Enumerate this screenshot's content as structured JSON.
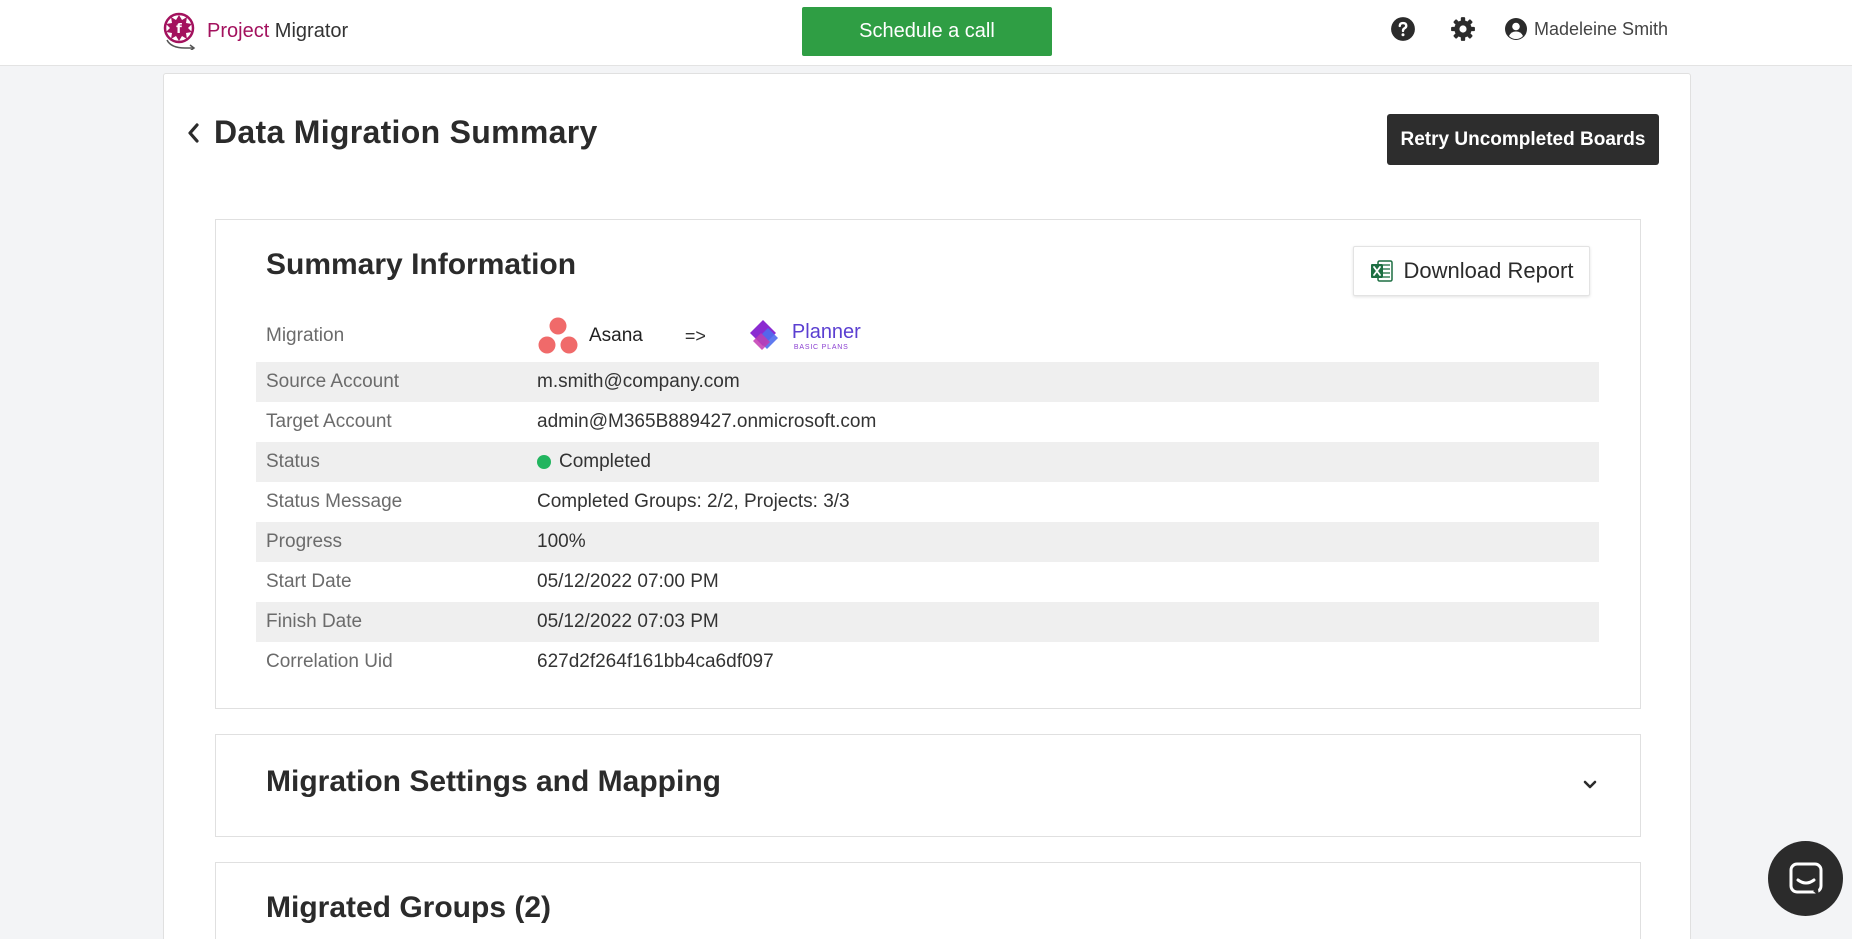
{
  "header": {
    "logo_accent": "Project",
    "logo_rest": " Migrator",
    "schedule_label": "Schedule a call",
    "user_name": "Madeleine Smith",
    "icons": [
      "help-icon",
      "gear-icon",
      "user-icon"
    ]
  },
  "page": {
    "title": "Data Migration Summary",
    "retry_label": "Retry Uncompleted Boards"
  },
  "summary": {
    "title": "Summary Information",
    "download_label": "Download Report",
    "migration_label": "Migration",
    "source_app": "Asana",
    "arrow": "=>",
    "target_app": "Planner",
    "target_sub": "BASIC PLANS",
    "rows": [
      {
        "label": "Source Account",
        "value": "m.smith@company.com"
      },
      {
        "label": "Target Account",
        "value": "admin@M365B889427.onmicrosoft.com"
      },
      {
        "label": "Status",
        "value": "Completed"
      },
      {
        "label": "Status Message",
        "value": "Completed Groups: 2/2, Projects: 3/3"
      },
      {
        "label": "Progress",
        "value": "100%"
      },
      {
        "label": "Start Date",
        "value": "05/12/2022 07:00 PM"
      },
      {
        "label": "Finish Date",
        "value": "05/12/2022 07:03 PM"
      },
      {
        "label": "Correlation Uid",
        "value": "627d2f264f161bb4ca6df097"
      }
    ]
  },
  "settings": {
    "title": "Migration Settings and Mapping"
  },
  "groups": {
    "title": "Migrated Groups (2)"
  },
  "colors": {
    "brand": "#a3125e",
    "schedule_button": "#2f9e44",
    "retry_button": "#2d2d2d",
    "status_completed": "#22b55f"
  }
}
